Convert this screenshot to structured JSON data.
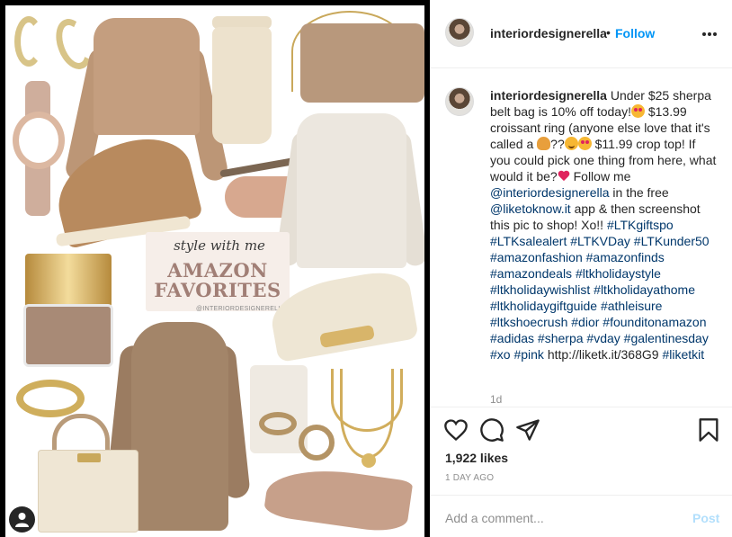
{
  "post": {
    "username": "interiordesignerella",
    "separator": "•",
    "follow_label": "Follow",
    "more_icon": "more-horizontal-icon",
    "image": {
      "script_text": "style with me",
      "headline": "AMAZON FAVORITES",
      "handle": "@INTERIORDESIGNERELLA",
      "tag_icon": "user-tag-icon"
    }
  },
  "caption": {
    "username": "interiordesignerella",
    "seg1": " Under $25 sherpa belt bag is 10% off today!",
    "seg2": " $13.99 croissant ring (anyone else love that it's called a ",
    "seg3": "??",
    "seg4": " $11.99 crop top! If you could pick one thing from here, what would it be?",
    "seg5": " Follow me ",
    "mention1": "@interiordesignerella",
    "seg6": " in the free ",
    "mention2": "@liketoknow.it",
    "seg7": " app & then screenshot this pic to shop! Xo!! ",
    "hashtags1": "#LTKgiftspo #LTKsalealert #LTKVDay #LTKunder50 #amazonfashion #amazonfinds #amazondeals #ltkholidaystyle #ltkholidaywishlist #ltkholidayathome #ltkholidaygiftguide #athleisure #ltkshoecrush #dior #founditonamazon #adidas #sherpa #vday #galentinesday #xo #pink",
    "link": " http://liketk.it/368G9 ",
    "hashtag_last": "#liketkit",
    "age": "1d"
  },
  "actions": {
    "like_icon": "heart-icon",
    "comment_icon": "comment-icon",
    "share_icon": "send-icon",
    "save_icon": "bookmark-icon",
    "likes": "1,922 likes",
    "time": "1 DAY AGO"
  },
  "comment": {
    "placeholder": "Add a comment...",
    "post_label": "Post"
  },
  "colors": {
    "link_blue": "#0095f6",
    "hashtag": "#00376b",
    "muted": "#8e8e8e",
    "post_disabled": "#b2dffc"
  }
}
